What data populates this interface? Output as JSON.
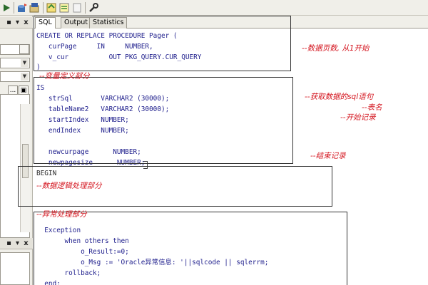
{
  "toolbar": {
    "icons": [
      "run-icon",
      "db-icon",
      "save-icon",
      "new-icon",
      "doc-icon",
      "wrench-icon"
    ]
  },
  "left_panel": {
    "controls": [
      "▾",
      "x"
    ],
    "browse_button": "...",
    "copy_button": "▣"
  },
  "tabs": [
    {
      "label": "SQL",
      "active": true
    },
    {
      "label": "Output",
      "active": false
    },
    {
      "label": "Statistics",
      "active": false
    }
  ],
  "editor": {
    "header_lines": [
      "CREATE OR REPLACE PROCEDURE Pager (",
      "   curPage     IN     NUMBER,",
      "   v_cur          OUT PKG_QUERY.CUR_QUERY",
      ")"
    ],
    "var_lines": [
      "IS",
      "   strSql       VARCHAR2 (30000);",
      "   tableName2   VARCHAR2 (30000);",
      "   startIndex   NUMBER;",
      "   endIndex     NUMBER;",
      "",
      "   newcurpage      NUMBER;",
      "   newpagesize      NUMBER;"
    ],
    "begin_line": "BEGIN",
    "exception_lines": [
      "  Exception",
      "       when others then",
      "           o_Result:=0;",
      "           o_Msg := 'Oracle异常信息: '||sqlcode || sqlerrm;",
      "       rollback;",
      "  end;"
    ]
  },
  "annotations": {
    "page_count": "--数据页数, 从1开始",
    "var_section": "--变量定义部分",
    "get_sql": "--获取数据的sql语句",
    "table_name": "--表名",
    "start_record": "--开始记录",
    "end_record": "--结束记录",
    "logic_section": "--数据逻辑处理部分",
    "exception_section": "--异常处理部分"
  }
}
